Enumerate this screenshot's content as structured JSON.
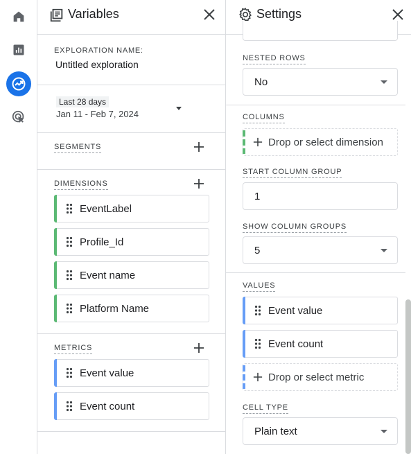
{
  "rail": {
    "items": [
      {
        "name": "home",
        "icon": "home-icon"
      },
      {
        "name": "reports",
        "icon": "bar-chart-icon"
      },
      {
        "name": "explore",
        "icon": "explore-icon",
        "active": true
      },
      {
        "name": "advertising",
        "icon": "target-cursor-icon"
      }
    ]
  },
  "variables": {
    "title": "Variables",
    "exploration_name_label": "EXPLORATION NAME:",
    "exploration_name": "Untitled exploration",
    "date_range_badge": "Last 28 days",
    "date_range": "Jan 11 - Feb 7, 2024",
    "segments_label": "SEGMENTS",
    "dimensions_label": "DIMENSIONS",
    "dimensions": [
      "EventLabel",
      "Profile_Id",
      "Event name",
      "Platform Name"
    ],
    "metrics_label": "METRICS",
    "metrics": [
      "Event value",
      "Event count"
    ]
  },
  "settings": {
    "title": "Settings",
    "nested_rows_label": "NESTED ROWS",
    "nested_rows_value": "No",
    "columns_label": "COLUMNS",
    "columns_drop": "Drop or select dimension",
    "start_column_group_label": "START COLUMN GROUP",
    "start_column_group_value": "1",
    "show_column_groups_label": "SHOW COLUMN GROUPS",
    "show_column_groups_value": "5",
    "values_label": "VALUES",
    "values": [
      "Event value",
      "Event count"
    ],
    "values_drop": "Drop or select metric",
    "cell_type_label": "CELL TYPE",
    "cell_type_value": "Plain text"
  },
  "colors": {
    "accent": "#1a73e8",
    "dimension": "#5bb974",
    "metric": "#669df6"
  }
}
